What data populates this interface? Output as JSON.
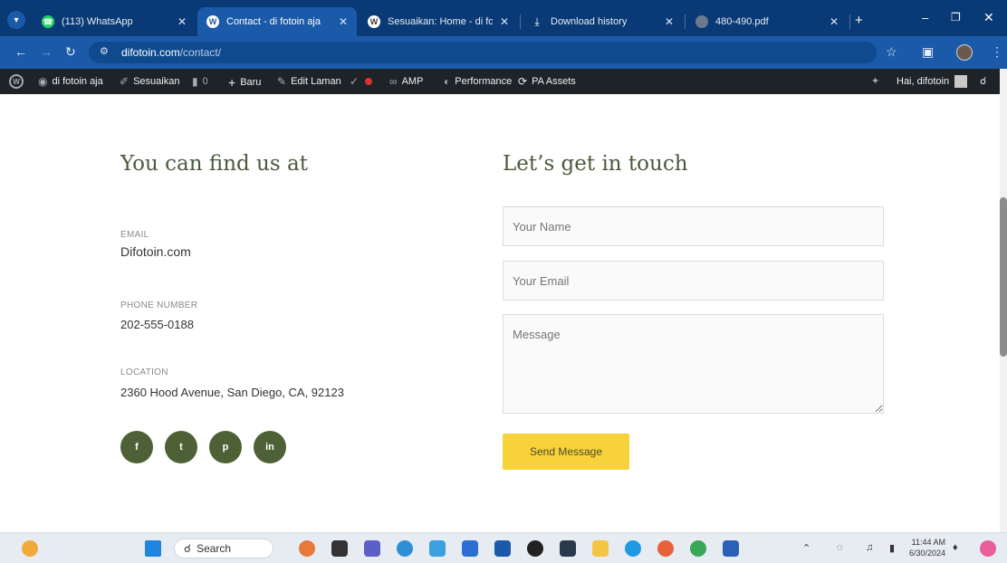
{
  "browser": {
    "tabs": [
      {
        "label": "(113) WhatsApp",
        "icon": "whatsapp-icon",
        "color": "#25d366",
        "active": false
      },
      {
        "label": "Contact - di fotoin aja",
        "icon": "wordpress-icon",
        "color": "#1e6cc0",
        "active": true
      },
      {
        "label": "Sesuaikan: Home - di fotoin",
        "icon": "wordpress-icon",
        "color": "#3b3b3b",
        "active": false
      },
      {
        "label": "Download history",
        "icon": "download-icon",
        "color": "#0a3a75",
        "active": false
      },
      {
        "label": "480-490.pdf",
        "icon": "globe-icon",
        "color": "#6b7a8f",
        "active": false
      }
    ],
    "url_domain": "difotoin.com",
    "url_path": "/contact/"
  },
  "admin_bar": {
    "site_name": "di fotoin aja",
    "customize": "Sesuaikan",
    "comments_count": "0",
    "new": "Baru",
    "edit_page": "Edit Laman",
    "amp": "AMP",
    "performance": "Performance",
    "pa_assets": "PA Assets",
    "greeting": "Hai, difotoin"
  },
  "contact": {
    "find_heading": "You can find us at",
    "touch_heading": "Let’s get in touch",
    "email_label": "EMAIL",
    "email_value": "Difotoin.com",
    "phone_label": "PHONE NUMBER",
    "phone_value": "202-555-0188",
    "location_label": "LOCATION",
    "location_value": "2360 Hood Avenue, San Diego, CA, 92123",
    "social": [
      {
        "name": "facebook-icon",
        "glyph": "f"
      },
      {
        "name": "twitter-icon",
        "glyph": "t"
      },
      {
        "name": "pinterest-icon",
        "glyph": "p"
      },
      {
        "name": "linkedin-icon",
        "glyph": "in"
      }
    ],
    "name_placeholder": "Your Name",
    "email_placeholder": "Your Email",
    "message_placeholder": "Message",
    "send_label": "Send Message",
    "accent_green": "#4e6136",
    "button_yellow": "#f8d23a"
  },
  "taskbar": {
    "search_label": "Search",
    "time": "11:44 AM",
    "date": "6/30/2024"
  }
}
